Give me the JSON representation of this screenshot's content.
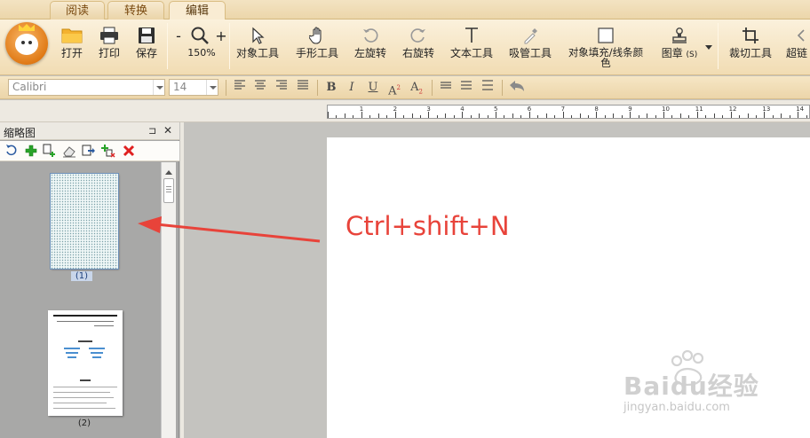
{
  "tabs": [
    {
      "label": "阅读",
      "active": false
    },
    {
      "label": "转换",
      "active": false
    },
    {
      "label": "编辑",
      "active": true
    }
  ],
  "ribbon": {
    "open": "打开",
    "print": "打印",
    "save": "保存",
    "zoom_minus": "-",
    "zoom_plus": "+",
    "zoom_level": "150%",
    "object_tool": "对象工具",
    "hand_tool": "手形工具",
    "rotate_left": "左旋转",
    "rotate_right": "右旋转",
    "text_tool": "文本工具",
    "eyedropper_tool": "吸管工具",
    "fill_line_color": "对象填充/线条颜色",
    "stamp": "图章",
    "stamp_shortcut": "(S)",
    "crop_tool": "裁切工具",
    "overflow_tool": "超链"
  },
  "format": {
    "font_family": "Calibri",
    "font_size": "14",
    "bold": "B",
    "italic": "I",
    "underline": "U",
    "superscript": "A",
    "superscript_mark": "2",
    "subscript": "A",
    "subscript_mark": "2"
  },
  "ruler": {
    "numbers": [
      "1",
      "2",
      "3",
      "4",
      "5",
      "6",
      "7",
      "8",
      "9",
      "10",
      "11",
      "12",
      "13",
      "14"
    ]
  },
  "thumbnail_panel": {
    "title": "缩略图",
    "pin": "⊐",
    "close": "✕",
    "pages": [
      {
        "label": "(1)"
      },
      {
        "label": "(2)"
      }
    ]
  },
  "annotation": {
    "text": "Ctrl+shift+N"
  },
  "colors": {
    "accent_orange": "#e07a16",
    "annotation_red": "#e8433a"
  },
  "watermark": {
    "brand": "Baidu经验",
    "url": "jingyan.baidu.com"
  }
}
